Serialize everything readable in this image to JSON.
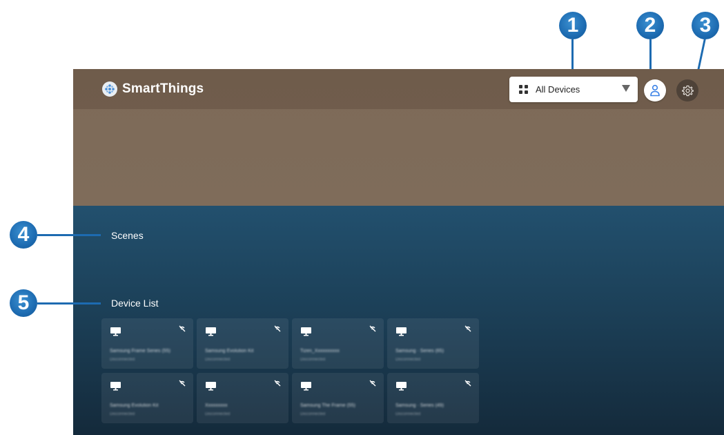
{
  "header": {
    "app_title": "SmartThings",
    "dropdown_label": "All Devices"
  },
  "sections": {
    "scenes_title": "Scenes",
    "device_list_title": "Device List"
  },
  "devices": [
    {
      "name": "Samsung Frame Series (55)",
      "status": "Disconnected"
    },
    {
      "name": "Samsung Evolution Kit",
      "status": "Disconnected"
    },
    {
      "name": "Tizen_Xxxxxxxxxx",
      "status": "Disconnected"
    },
    {
      "name": "Samsung · Series (65)",
      "status": "Disconnected"
    },
    {
      "name": "Samsung Evolution Kit",
      "status": "Disconnected"
    },
    {
      "name": "Xxxxxxxxx",
      "status": "Disconnected"
    },
    {
      "name": "Samsung The Frame (55)",
      "status": "Disconnected"
    },
    {
      "name": "Samsung · Series (49)",
      "status": "Disconnected"
    }
  ],
  "callouts": [
    "1",
    "2",
    "3",
    "4",
    "5"
  ],
  "icons": {
    "logo": "smartthings-logo-icon",
    "dropdown": "grid-icon",
    "caret": "caret-down-icon",
    "profile": "user-icon",
    "settings": "gear-icon",
    "device": "monitor-icon",
    "status": "disconnected-icon"
  },
  "colors": {
    "callout": "#1d6bb1",
    "hero": "#7d6a58",
    "lower": "#1c4058",
    "profile_accent": "#3b82e6"
  }
}
